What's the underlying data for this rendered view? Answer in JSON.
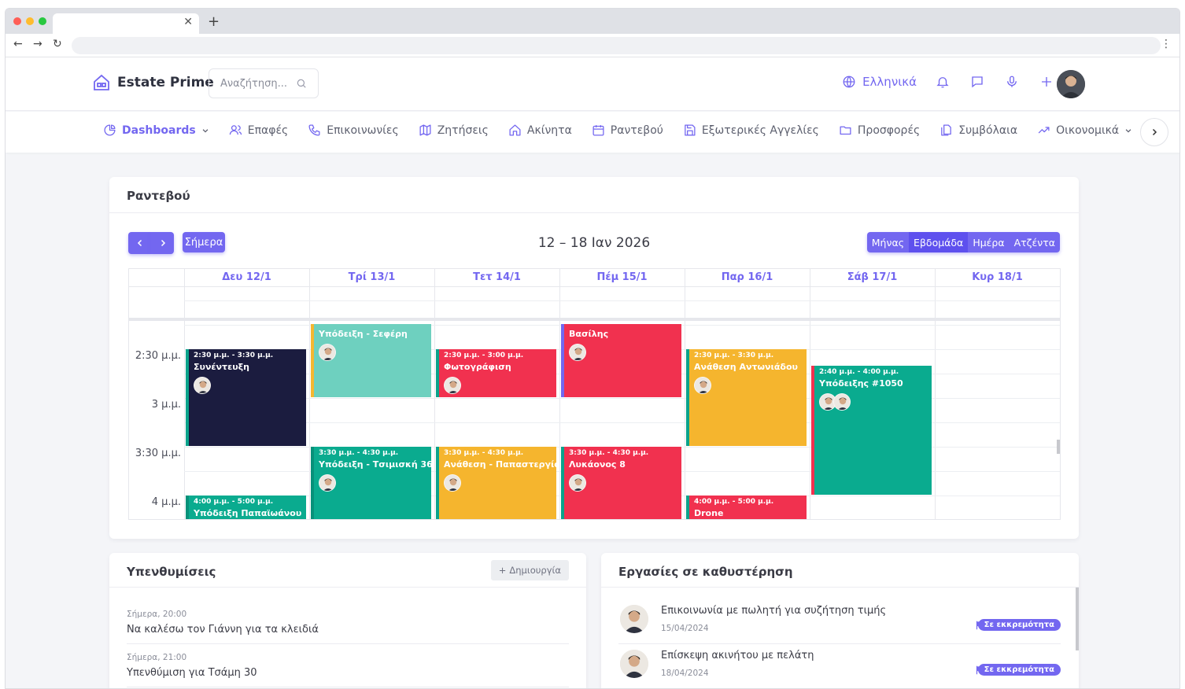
{
  "app": {
    "name": "Estate Prime"
  },
  "search": {
    "placeholder": "Αναζήτηση..."
  },
  "header": {
    "language": "Ελληνικά"
  },
  "menu": [
    {
      "label": "Dashboards",
      "icon": "pie-chart-icon",
      "active": true,
      "dropdown": true
    },
    {
      "label": "Επαφές",
      "icon": "users-icon"
    },
    {
      "label": "Επικοινωνίες",
      "icon": "phone-icon"
    },
    {
      "label": "Ζητήσεις",
      "icon": "map-icon"
    },
    {
      "label": "Ακίνητα",
      "icon": "home-icon"
    },
    {
      "label": "Ραντεβού",
      "icon": "calendar-icon"
    },
    {
      "label": "Εξωτερικές Αγγελίες",
      "icon": "save-icon"
    },
    {
      "label": "Προσφορές",
      "icon": "folder-icon"
    },
    {
      "label": "Συμβόλαια",
      "icon": "files-icon"
    },
    {
      "label": "Οικονομικά",
      "icon": "trending-up-icon",
      "dropdown": true
    }
  ],
  "calendar": {
    "title": "Ραντεβού",
    "today_label": "Σήμερα",
    "range": "12 – 18 Ιαν 2026",
    "views": [
      {
        "label": "Μήνας"
      },
      {
        "label": "Εβδομάδα",
        "active": true
      },
      {
        "label": "Ημέρα"
      },
      {
        "label": "Ατζέντα"
      }
    ],
    "days": [
      "Δευ 12/1",
      "Τρί 13/1",
      "Τετ 14/1",
      "Πέμ 15/1",
      "Παρ 16/1",
      "Σάβ 17/1",
      "Κυρ 18/1"
    ],
    "time_labels": [
      "2:30 μ.μ.",
      "3 μ.μ.",
      "3:30 μ.μ.",
      "4 μ.μ."
    ],
    "events": [
      {
        "day": 0,
        "start": 14.5,
        "end": 15.5,
        "time": "2:30 μ.μ. - 3:30 μ.μ.",
        "title": "Συνέντευξη",
        "color": "#1b1c3f",
        "border": "#0aa38b",
        "avatars": 1
      },
      {
        "day": 0,
        "start": 16.0,
        "end": 17.0,
        "time": "4:00 μ.μ. - 5:00 μ.μ.",
        "title": "Υπόδειξη Παπαϊωάνου",
        "color": "#0aab8f",
        "border": "#07917a",
        "avatars": 1
      },
      {
        "day": 1,
        "start": 14.0,
        "end": 15.0,
        "time": "",
        "title": "Υπόδειξη - Σεφέρη",
        "color": "#6ed0bf",
        "border": "#f4b731",
        "avatars": 1
      },
      {
        "day": 1,
        "start": 15.5,
        "end": 16.5,
        "time": "3:30 μ.μ. - 4:30 μ.μ.",
        "title": "Υπόδειξη - Τσιμισκή 36",
        "color": "#0aab8f",
        "border": "#07917a",
        "avatars": 1
      },
      {
        "day": 2,
        "start": 14.5,
        "end": 15.0,
        "time": "2:30 μ.μ. - 3:00 μ.μ.",
        "title": "Φωτογράφιση",
        "color": "#f1314f",
        "border": "#0aa38b",
        "avatars": 1
      },
      {
        "day": 2,
        "start": 15.5,
        "end": 16.5,
        "time": "3:30 μ.μ. - 4:30 μ.μ.",
        "title": "Ανάθεση - Παπαστεργίου",
        "color": "#f5b52e",
        "border": "#0aa38b",
        "avatars": 1
      },
      {
        "day": 3,
        "start": 14.0,
        "end": 15.0,
        "time": "",
        "title": "Βασίλης",
        "color": "#f1314f",
        "border": "#7367f0",
        "avatars": 1
      },
      {
        "day": 3,
        "start": 15.5,
        "end": 16.5,
        "time": "3:30 μ.μ. - 4:30 μ.μ.",
        "title": "Λυκάονος 8",
        "color": "#f1314f",
        "border": "#0aa38b",
        "avatars": 1
      },
      {
        "day": 4,
        "start": 14.5,
        "end": 15.5,
        "time": "2:30 μ.μ. - 3:30 μ.μ.",
        "title": "Ανάθεση Αντωνιάδου",
        "color": "#f5b52e",
        "border": "#0aa38b",
        "avatars": 1
      },
      {
        "day": 4,
        "start": 16.0,
        "end": 17.0,
        "time": "4:00 μ.μ. - 5:00 μ.μ.",
        "title": "Drone",
        "color": "#f1314f",
        "border": "#0aa38b",
        "avatars": 1
      },
      {
        "day": 5,
        "start": 14.6667,
        "end": 16.0,
        "time": "2:40 μ.μ. - 4:00 μ.μ.",
        "title": "Υπόδειξης #1050",
        "color": "#0aab8f",
        "border": "#f1314f",
        "avatars": 2
      }
    ]
  },
  "reminders": {
    "title": "Υπενθυμίσεις",
    "create_label": "Δημιουργία",
    "items": [
      {
        "time": "Σήμερα, 20:00",
        "text": "Να καλέσω τον Γιάννη για τα κλειδιά"
      },
      {
        "time": "Σήμερα, 21:00",
        "text": "Υπενθύμιση για Τσάμη 30"
      }
    ]
  },
  "tasks": {
    "title": "Εργασίες σε καθυστέρηση",
    "items": [
      {
        "title": "Επικοινωνία με πωλητή για συζήτηση τιμής",
        "date": "15/04/2024",
        "status": "Σε εκκρεμότητα"
      },
      {
        "title": "Επίσκεψη ακινήτου με πελάτη",
        "date": "18/04/2024",
        "status": "Σε εκκρεμότητα"
      }
    ]
  },
  "colors": {
    "accent": "#7367f0",
    "navy": "#1b1c3f",
    "teal": "#0aab8f",
    "red": "#f1314f",
    "yellow": "#f5b52e"
  }
}
